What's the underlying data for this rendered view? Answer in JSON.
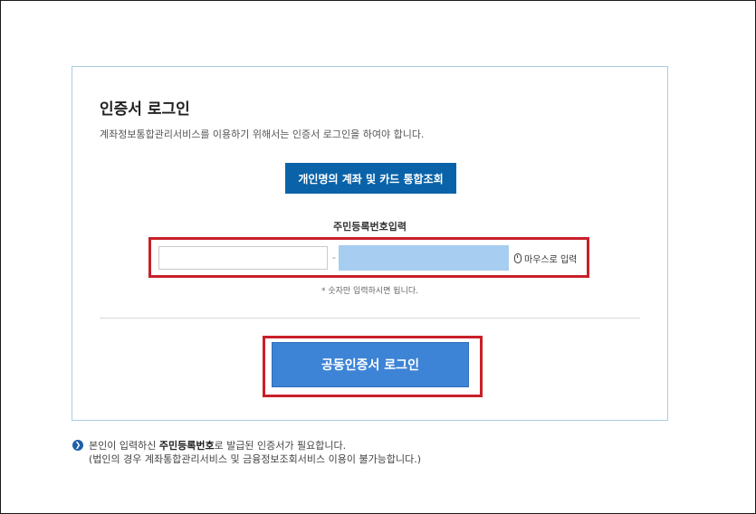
{
  "login": {
    "title": "인증서 로그인",
    "description": "계좌정보통합관리서비스를 이용하기 위해서는 인증서 로그인을 하여야 합니다.",
    "tab_button": "개인명의 계좌 및 카드 통합조회",
    "id_label": "주민등록번호입력",
    "ssn_front_value": "",
    "ssn_separator": "-",
    "ssn_back_value": "",
    "mouse_input_label": "마우스로 입력",
    "hint": "* 숫자만 입력하시면 됩니다.",
    "login_button": "공동인증서 로그인"
  },
  "notice": {
    "line1_prefix": "본인이 입력하신 ",
    "line1_bold": "주민등록번호",
    "line1_suffix": "로 발급된 인증서가 필요합니다.",
    "line2": "(법인의 경우 계좌통합관리서비스 및 금융정보조회서비스 이용이 불가능합니다.)"
  },
  "colors": {
    "primary_blue": "#0a63a8",
    "login_blue": "#3d84d6",
    "highlight_red": "#c8202a",
    "panel_border": "#a9cde3",
    "masked_input": "#a7cdf0"
  }
}
